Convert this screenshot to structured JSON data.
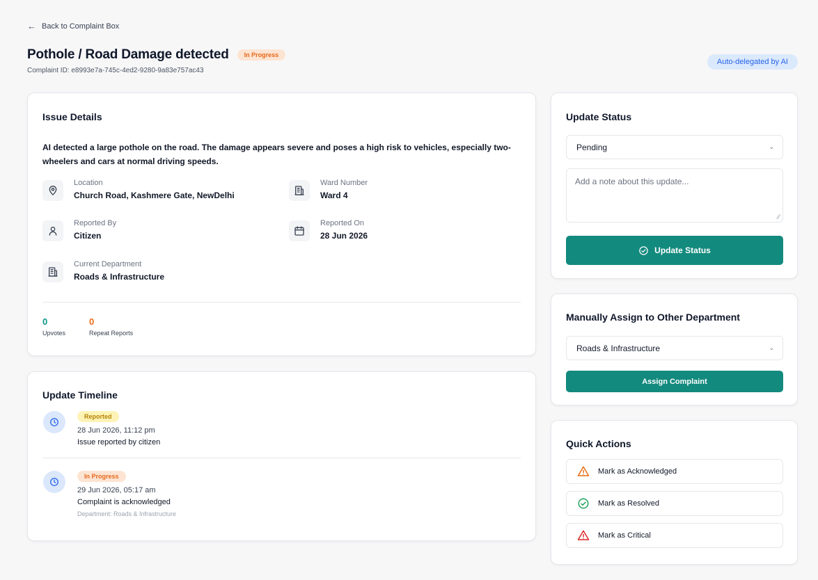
{
  "header": {
    "back_label": "Back to Complaint Box",
    "title": "Pothole / Road Damage detected",
    "status_badge": "In Progress",
    "complaint_id": "Complaint ID: e8993e7a-745c-4ed2-9280-9a83e757ac43",
    "ai_badge": "Auto-delegated by AI"
  },
  "issue": {
    "title": "Issue Details",
    "description": "AI detected a large pothole on the road. The damage appears severe and poses a high risk to vehicles, especially two-wheelers and cars at normal driving speeds.",
    "location": {
      "label": "Location",
      "value": "Church Road, Kashmere Gate, NewDelhi",
      "icon": "map-pin-icon"
    },
    "ward": {
      "label": "Ward Number",
      "value": "Ward 4",
      "icon": "building-icon"
    },
    "reported_by": {
      "label": "Reported By",
      "value": "Citizen",
      "icon": "user-icon"
    },
    "reported_on": {
      "label": "Reported On",
      "value": "28 Jun 2026",
      "icon": "calendar-icon"
    },
    "department": {
      "label": "Current Department",
      "value": "Roads & Infrastructure",
      "icon": "building-icon"
    },
    "stats": {
      "upvotes": {
        "value": "0",
        "label": "Upvotes"
      },
      "repeats": {
        "value": "0",
        "label": "Repeat Reports"
      }
    }
  },
  "timeline": {
    "title": "Update Timeline",
    "items": [
      {
        "badge": "Reported",
        "date": "28 Jun 2026, 11:12 pm",
        "message": "Issue reported by citizen"
      },
      {
        "badge": "In Progress",
        "date": "29 Jun 2026, 05:17 am",
        "message": "Complaint is acknowledged",
        "department": "Department: Roads & Infrastructure"
      }
    ]
  },
  "update_status": {
    "title": "Update Status",
    "selected": "Pending",
    "note_placeholder": "Add a note about this update...",
    "button": "Update Status"
  },
  "assign": {
    "title": "Manually Assign to Other Department",
    "selected": "Roads & Infrastructure",
    "button": "Assign Complaint"
  },
  "quick_actions": {
    "title": "Quick Actions",
    "acknowledge": "Mark as Acknowledged",
    "resolve": "Mark as Resolved",
    "critical": "Mark as Critical"
  },
  "colors": {
    "primary": "#138a7e",
    "teal_stat": "#0d9488",
    "orange_stat": "#ea6c14",
    "ai_badge_text": "#2563eb",
    "warning": "#ea6c14",
    "success": "#22a35a",
    "danger": "#dc2626"
  }
}
